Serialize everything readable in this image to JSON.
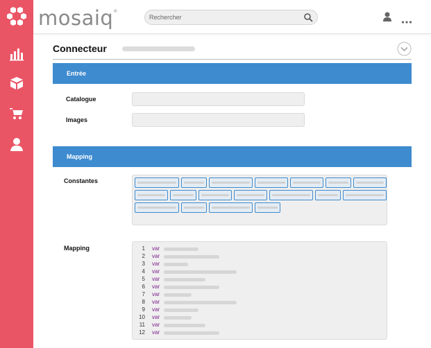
{
  "app": {
    "brand": "mosaiq",
    "brand_mark": "®",
    "accent_color": "#ea5566",
    "section_color": "#3e8bcf"
  },
  "header": {
    "search_placeholder": "Rechercher",
    "icons": [
      "search-icon",
      "user-icon",
      "more-icon"
    ]
  },
  "sidebar": {
    "items": [
      {
        "icon": "bar-chart-icon"
      },
      {
        "icon": "box-icon"
      },
      {
        "icon": "cart-icon"
      },
      {
        "icon": "user-badge-icon"
      }
    ]
  },
  "page": {
    "title": "Connecteur"
  },
  "sections": {
    "entree": {
      "title": "Entrée",
      "fields": [
        {
          "label": "Catalogue",
          "value": ""
        },
        {
          "label": "Images",
          "value": ""
        }
      ]
    },
    "mapping": {
      "title": "Mapping",
      "constants_label": "Constantes",
      "mapping_label": "Mapping",
      "code_lines": [
        {
          "n": "1",
          "kw": "var"
        },
        {
          "n": "2",
          "kw": "var"
        },
        {
          "n": "3",
          "kw": "var"
        },
        {
          "n": "4",
          "kw": "var"
        },
        {
          "n": "5",
          "kw": "var"
        },
        {
          "n": "6",
          "kw": "var"
        },
        {
          "n": "7",
          "kw": "var"
        },
        {
          "n": "8",
          "kw": "var"
        },
        {
          "n": "9",
          "kw": "var"
        },
        {
          "n": "10",
          "kw": "var"
        },
        {
          "n": "11",
          "kw": "var"
        },
        {
          "n": "12",
          "kw": "var"
        }
      ]
    }
  }
}
